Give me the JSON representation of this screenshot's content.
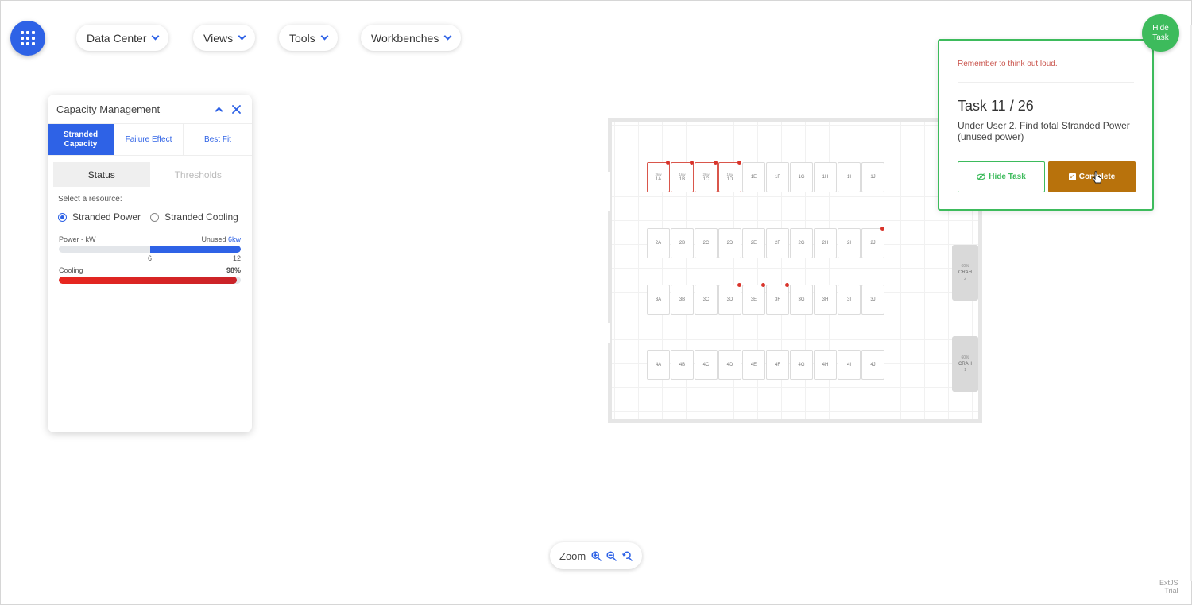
{
  "nav": {
    "menus": [
      "Data Center",
      "Views",
      "Tools",
      "Workbenches"
    ]
  },
  "capacity": {
    "title": "Capacity Management",
    "tabs": [
      "Stranded Capacity",
      "Failure Effect",
      "Best Fit"
    ],
    "active_tab": "Stranded Capacity",
    "subtabs": [
      "Status",
      "Thresholds"
    ],
    "active_subtab": "Status",
    "select_label": "Select a resource:",
    "options": [
      "Stranded Power",
      "Stranded Cooling"
    ],
    "selected_option": "Stranded Power",
    "power": {
      "label": "Power - kW",
      "unused_label": "Unused",
      "unused_value": "6kw",
      "tick_low": "6",
      "tick_high": "12",
      "unused_fraction": 0.5
    },
    "cooling": {
      "label": "Cooling",
      "value_label": "98%",
      "fraction": 0.98
    }
  },
  "floor": {
    "rows": [
      {
        "racks": [
          {
            "label": "1A",
            "kw": "2kw",
            "alert": true,
            "dot": true
          },
          {
            "label": "1B",
            "kw": "1kw",
            "alert": true,
            "dot": true
          },
          {
            "label": "1C",
            "kw": "2kw",
            "alert": true,
            "dot": true
          },
          {
            "label": "1D",
            "kw": "1kw",
            "alert": true,
            "dot": true
          },
          {
            "label": "1E"
          },
          {
            "label": "1F"
          },
          {
            "label": "1G"
          },
          {
            "label": "1H"
          },
          {
            "label": "1I"
          },
          {
            "label": "1J"
          }
        ]
      },
      {
        "racks": [
          {
            "label": "2A"
          },
          {
            "label": "2B"
          },
          {
            "label": "2C"
          },
          {
            "label": "2D"
          },
          {
            "label": "2E"
          },
          {
            "label": "2F"
          },
          {
            "label": "2G"
          },
          {
            "label": "2H"
          },
          {
            "label": "2I"
          },
          {
            "label": "2J",
            "dot": true
          }
        ]
      },
      {
        "racks": [
          {
            "label": "3A"
          },
          {
            "label": "3B"
          },
          {
            "label": "3C"
          },
          {
            "label": "3D",
            "dot": true
          },
          {
            "label": "3E",
            "dot": true
          },
          {
            "label": "3F",
            "dot": true
          },
          {
            "label": "3G"
          },
          {
            "label": "3H"
          },
          {
            "label": "3I"
          },
          {
            "label": "3J"
          }
        ]
      },
      {
        "racks": [
          {
            "label": "4A"
          },
          {
            "label": "4B"
          },
          {
            "label": "4C"
          },
          {
            "label": "4D"
          },
          {
            "label": "4E"
          },
          {
            "label": "4F"
          },
          {
            "label": "4G"
          },
          {
            "label": "4H"
          },
          {
            "label": "4I"
          },
          {
            "label": "4J"
          }
        ]
      }
    ],
    "crah_units": [
      {
        "pct": "60%",
        "label": "CRAH",
        "num": "2"
      },
      {
        "pct": "60%",
        "label": "CRAH",
        "num": "1"
      }
    ]
  },
  "task": {
    "reminder": "Remember to think out loud.",
    "number": "Task 11 / 26",
    "description": "Under User 2. Find total Stranded Power (unused power)",
    "hide_label": "Hide Task",
    "complete_label": "Complete",
    "hide_circle_label": "Hide Task"
  },
  "zoom": {
    "label": "Zoom"
  },
  "trial": {
    "line1": "ExtJS",
    "line2": "Trial"
  },
  "colors": {
    "accent": "#2e62e6",
    "task_green": "#3dbb5c",
    "complete_orange": "#b8720c",
    "alert_red": "#d9342b"
  }
}
